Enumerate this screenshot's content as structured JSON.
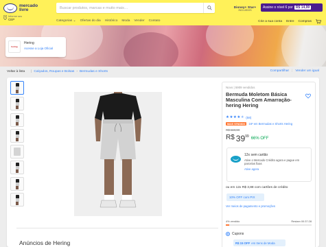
{
  "header": {
    "logo_text": "mercado livre",
    "search_placeholder": "Buscar produtos, marcas e muito mais…",
    "promo_top": "Disney+ Star+",
    "promo_bottom": "INCLUÍDOS",
    "promo_badge": "Assine o nível 6 por",
    "promo_price": "R$ 14,99",
    "cep_label": "Informe seu",
    "cep_value": "CEP",
    "nav": [
      "Categorias ⌄",
      "Ofertas do dia",
      "Histórico",
      "Moda",
      "Vender",
      "Contato"
    ],
    "account": [
      "Crie a sua conta",
      "Entre",
      "Compras"
    ]
  },
  "store": {
    "logo": "hering",
    "name": "Hering",
    "official": "Acesse a Loja Oficial"
  },
  "breadcrumb": {
    "back": "Voltar à lista",
    "items": [
      "Calçados, Roupas e Bolsas",
      "Bermudas e Shorts"
    ],
    "share": "Compartilhar",
    "sell": "Vender um igual"
  },
  "product": {
    "condition": "Novo  |  5909 vendidos",
    "title": "Bermuda Moletom Básica Masculina Com Amarração- hering Hering",
    "rating": 4.5,
    "rating_count": "(58)",
    "badge": "MAIS VENDIDO",
    "rank": "16º em Bermudas e Shorts Hering",
    "old_price": "R$ 119,99",
    "price_currency": "R$",
    "price_int": "39",
    "price_cents": "99",
    "discount": "66% OFF",
    "credit_title": "12x sem cartão",
    "credit_desc": "Ative o Mercado Crédito agora e pague em parcelas fixas",
    "credit_link": "Ative agora",
    "installments": "ou em 12x R$ 3,88 com cartões de crédito",
    "pix": "10% OFF com PIX",
    "payment_link": "Ver meios de pagamento e promoções",
    "sold_pct_label": "4% vendido",
    "sold_pct": 0.04,
    "remaining": "Restam 00:37:28",
    "coupons_label": "Cupons",
    "coupon_bold": "R$ 15 OFF",
    "coupon_text": "em Itens de Moda",
    "anuncios": "Anúncios de Hering"
  },
  "thumbnails": [
    "front-view",
    "front-full",
    "side-view",
    "back-view",
    "flat-front",
    "detail-1",
    "detail-2",
    "flat-back"
  ],
  "colors": {
    "header_yellow": "#fff159",
    "link_blue": "#3483fa",
    "discount_green": "#00a650",
    "best_seller_orange": "#ff7733",
    "promo_purple": "#4b1b8f"
  }
}
